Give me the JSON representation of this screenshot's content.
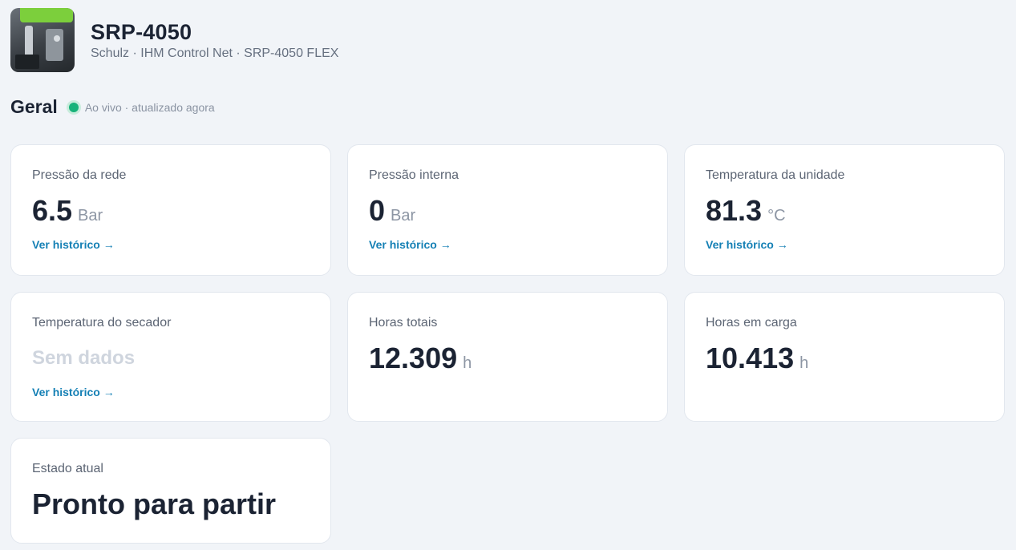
{
  "device": {
    "name": "SRP-4050",
    "subtitle": "Schulz · IHM Control Net · SRP-4050 FLEX"
  },
  "section": {
    "title": "Geral",
    "status": "Ao vivo · atualizado agora",
    "status_color": "#17b27a"
  },
  "cards": [
    {
      "label": "Pressão da rede",
      "value": "6.5",
      "unit": "Bar",
      "link": "Ver histórico →"
    },
    {
      "label": "Pressão interna",
      "value": "0",
      "unit": "Bar",
      "link": "Ver histórico →"
    },
    {
      "label": "Temperatura da unidade",
      "value": "81.3",
      "unit": "°C",
      "link": "Ver histórico →"
    },
    {
      "label": "Temperatura do secador",
      "value": "Sem dados",
      "link": "Ver histórico →"
    },
    {
      "label": "Horas totais",
      "value": "12.309",
      "unit": "h"
    },
    {
      "label": "Horas em carga",
      "value": "10.413",
      "unit": "h"
    },
    {
      "label": "Estado atual",
      "value": "Pronto para partir"
    }
  ],
  "colors": {
    "accent_link": "#1580b5",
    "background": "#f1f4f8"
  }
}
